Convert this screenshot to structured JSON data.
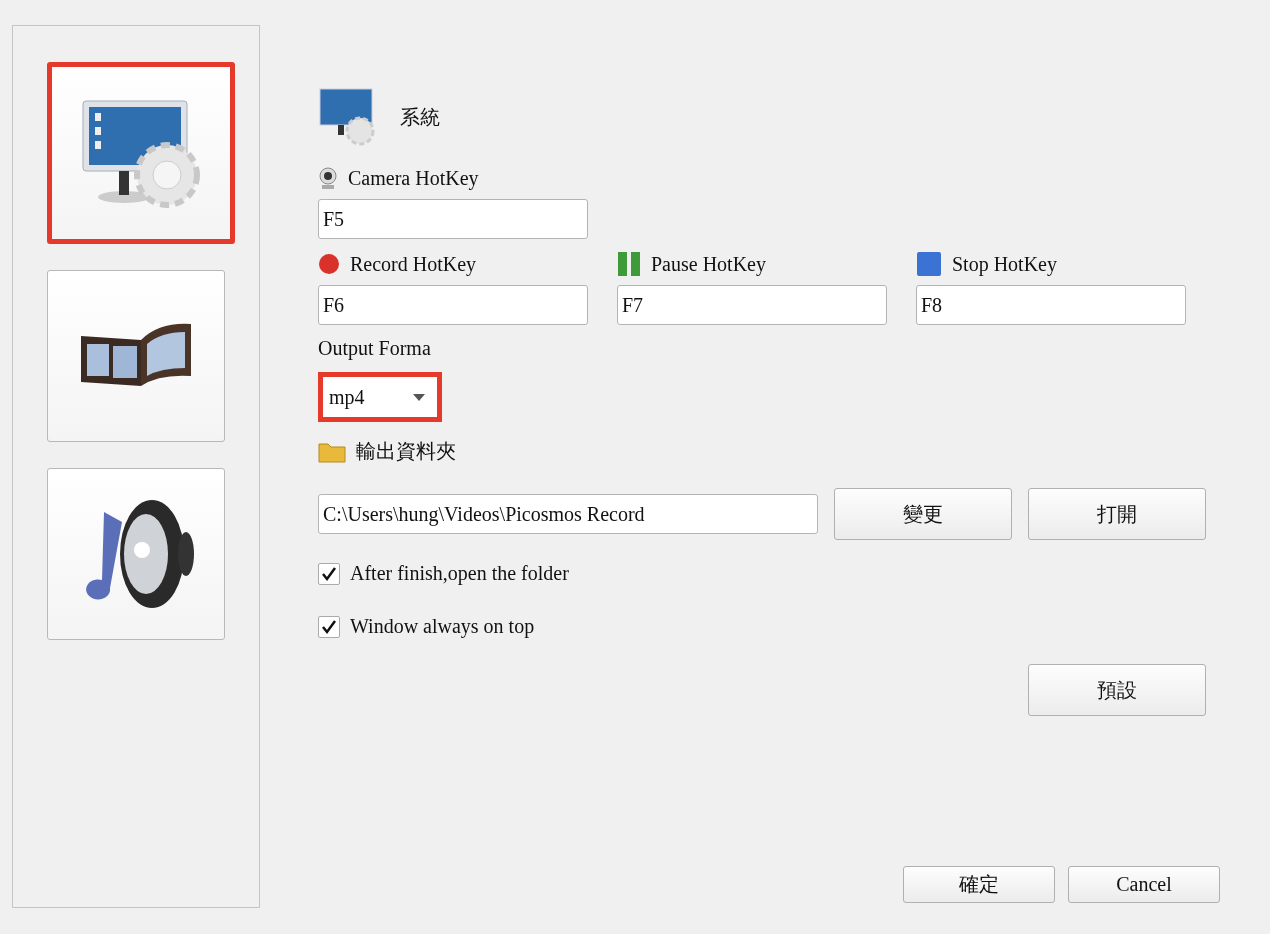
{
  "sidebar": {
    "items": [
      {
        "kind": "system",
        "selected": true
      },
      {
        "kind": "video",
        "selected": false
      },
      {
        "kind": "audio",
        "selected": false
      }
    ]
  },
  "section": {
    "title": "系統"
  },
  "hotkeys": [
    {
      "kind": "camera",
      "label": "Camera HotKey",
      "value": "F5"
    },
    {
      "kind": "record",
      "label": "Record HotKey",
      "value": "F6"
    },
    {
      "kind": "pause",
      "label": "Pause HotKey",
      "value": "F7"
    },
    {
      "kind": "stop",
      "label": "Stop HotKey",
      "value": "F8"
    }
  ],
  "output_format": {
    "label": "Output Forma",
    "value": "mp4",
    "highlighted": true
  },
  "output_folder": {
    "label": "輸出資料夾",
    "path": "C:\\Users\\hung\\Videos\\Picosmos Record",
    "buttons": [
      "變更",
      "打開"
    ]
  },
  "options": [
    {
      "label": "After finish,open the folder",
      "checked": true
    },
    {
      "label": "Window always on top",
      "checked": true
    }
  ],
  "default_button": "預設",
  "footer_buttons": [
    "確定",
    "Cancel"
  ]
}
